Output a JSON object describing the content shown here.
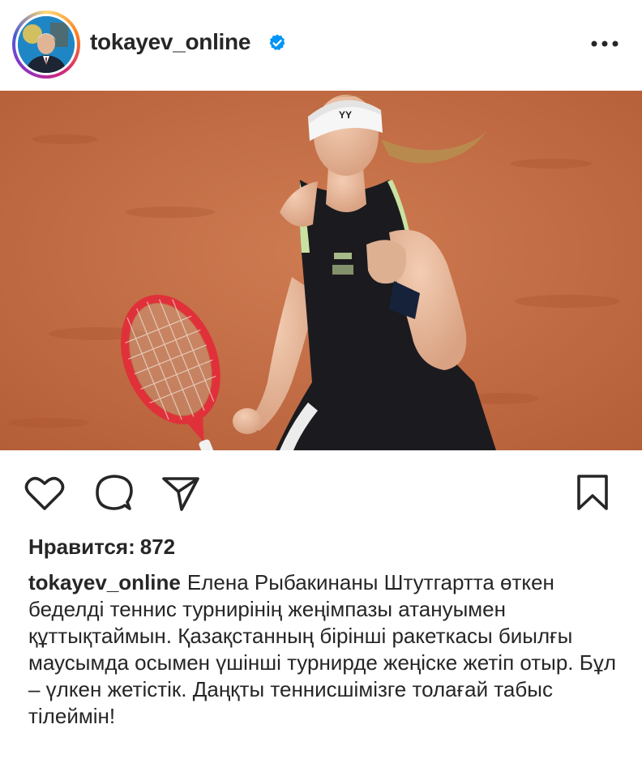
{
  "post": {
    "username": "tokayev_online",
    "verified": true
  },
  "header_icons": {
    "avatar": "avatar-photo",
    "verified": "verified-badge-icon",
    "more": "more-options-icon"
  },
  "photo": {
    "subject": "tennis player with racket",
    "icon": "post-photo"
  },
  "actions": {
    "like_icon": "heart-icon",
    "comment_icon": "comment-icon",
    "share_icon": "send-icon",
    "save_icon": "bookmark-icon"
  },
  "likes": {
    "label": "Нравится:",
    "count": "872"
  },
  "caption": {
    "username": "tokayev_online",
    "text": "Елена Рыбакинаны Штутгартта өткен беделді теннис турнирінің жеңімпазы атануымен құттықтаймын. Қазақстанның бірінші ракеткасы биылғы маусымда осымен үшінші турнирде жеңіске жетіп отыр. Бұл – үлкен жетістік. Даңқты теннисшімізге толағай табыс тілеймін!"
  },
  "colors": {
    "verified_blue": "#0095f6",
    "text": "#262626",
    "clay": "#c96f45"
  }
}
